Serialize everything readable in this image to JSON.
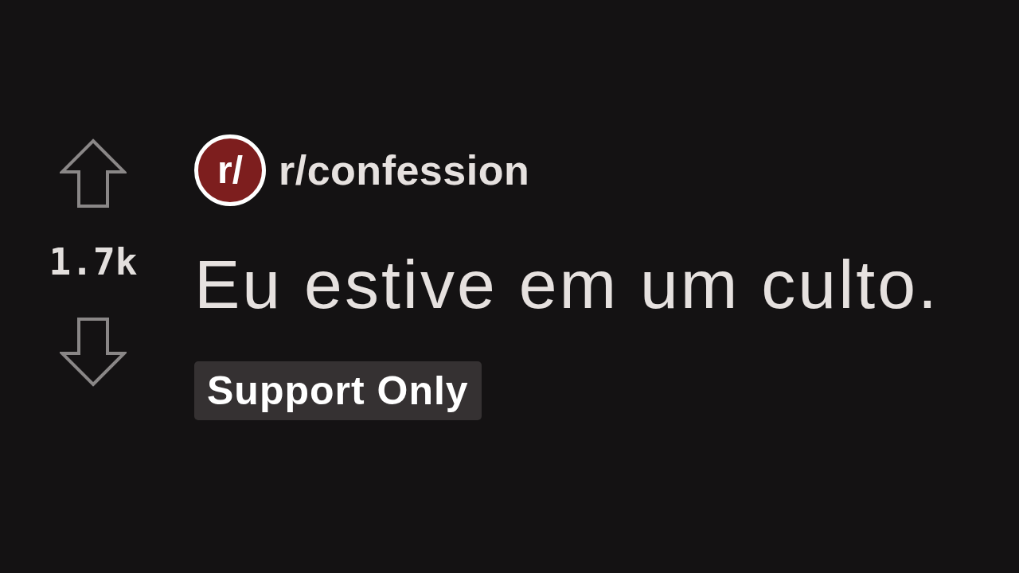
{
  "post": {
    "votes": {
      "score": "1.7k"
    },
    "community": {
      "icon_text": "r/",
      "name": "r/confession"
    },
    "title": "Eu estive em um culto.",
    "flair": "Support Only"
  }
}
